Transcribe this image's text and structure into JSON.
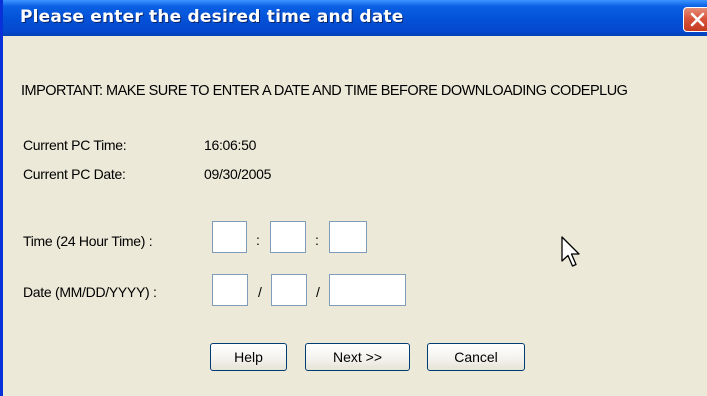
{
  "dialog": {
    "title": "Please enter the desired time and date",
    "important_message": "IMPORTANT: MAKE SURE TO ENTER A DATE AND TIME BEFORE DOWNLOADING CODEPLUG"
  },
  "current_pc": {
    "time_label": "Current PC Time:",
    "time_value": "16:06:50",
    "date_label": "Current PC Date:",
    "date_value": "09/30/2005"
  },
  "time_input": {
    "label": "Time (24 Hour Time) :",
    "separator": ":",
    "hours": "",
    "minutes": "",
    "seconds": ""
  },
  "date_input": {
    "label": "Date (MM/DD/YYYY) :",
    "separator": "/",
    "month": "",
    "day": "",
    "year": ""
  },
  "buttons": {
    "help": "Help",
    "next": "Next >>",
    "cancel": "Cancel"
  },
  "icons": {
    "close": "close-icon",
    "cursor": "mouse-pointer-icon"
  },
  "colors": {
    "titlebar": "#0351D6",
    "window_bg": "#ECE9D8",
    "close_button": "#D9553B",
    "input_border": "#7F9DB9"
  }
}
